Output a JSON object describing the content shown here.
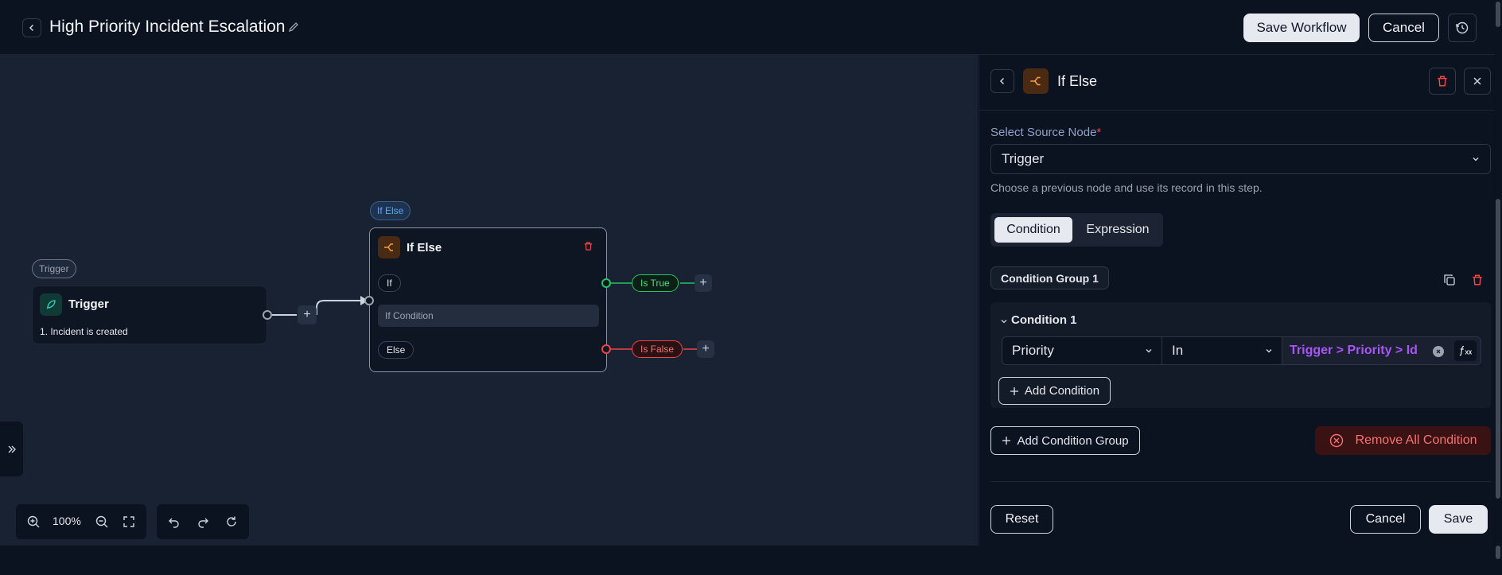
{
  "header": {
    "title": "High Priority Incident Escalation",
    "save_workflow": "Save Workflow",
    "cancel": "Cancel"
  },
  "canvas": {
    "trigger_tag": "Trigger",
    "trigger_title": "Trigger",
    "trigger_desc": "1. Incident is created",
    "ifelse_tag": "If Else",
    "ifelse_title": "If Else",
    "if_label": "If",
    "if_condition": "If Condition",
    "else_label": "Else",
    "is_true": "Is True",
    "is_false": "Is False",
    "zoom": "100%"
  },
  "panel": {
    "title": "If Else",
    "source_label": "Select Source Node",
    "required_mark": "*",
    "source_value": "Trigger",
    "source_help": "Choose a previous node and use its record in this step.",
    "tabs": [
      "Condition",
      "Expression"
    ],
    "group_label": "Condition Group 1",
    "condition_label": "Condition 1",
    "field_value": "Priority",
    "operator_value": "In",
    "value_text": "Trigger > Priority > Id",
    "add_condition": "Add Condition",
    "add_group": "Add Condition Group",
    "remove_all": "Remove All Condition",
    "reset": "Reset",
    "cancel": "Cancel",
    "save": "Save"
  },
  "colors": {
    "accent_orange": "#f59e42",
    "true_green": "#22c55e",
    "false_red": "#ef4444",
    "expr_purple": "#a855f7"
  }
}
